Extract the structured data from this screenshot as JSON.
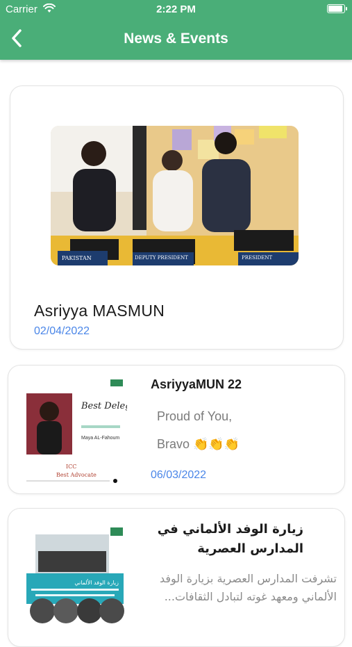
{
  "status_bar": {
    "carrier": "Carrier",
    "time": "2:22 PM"
  },
  "header": {
    "title": "News & Events",
    "back_icon": "chevron-left-icon"
  },
  "news": [
    {
      "title": "Asriyya MASMUN",
      "date": "02/04/2022",
      "image_labels": {
        "left": "PAKISTAN",
        "middle": "DEPUTY PRESIDENT",
        "right": "PRESIDENT"
      }
    },
    {
      "title": "AsriyyaMUN 22",
      "lines": [
        "Proud of You,",
        "Bravo 👏👏👏"
      ],
      "date": "06/03/2022",
      "thumb": {
        "heading": "Best Delegate!",
        "name": "Maya AL-Fahoum",
        "committee": "ICC",
        "award": "Best Advocate"
      }
    },
    {
      "title": "زيارة الوفد الألماني في المدارس العصرية",
      "body": "تشرفت المدارس العصرية بزيارة الوفد الألماني ومعهد غوته لتبادل الثقافات...",
      "thumb": {
        "heading": "زيارة الوفد الألماني"
      }
    }
  ],
  "colors": {
    "header_bg": "#4aae78",
    "date_color": "#4a86e8"
  }
}
